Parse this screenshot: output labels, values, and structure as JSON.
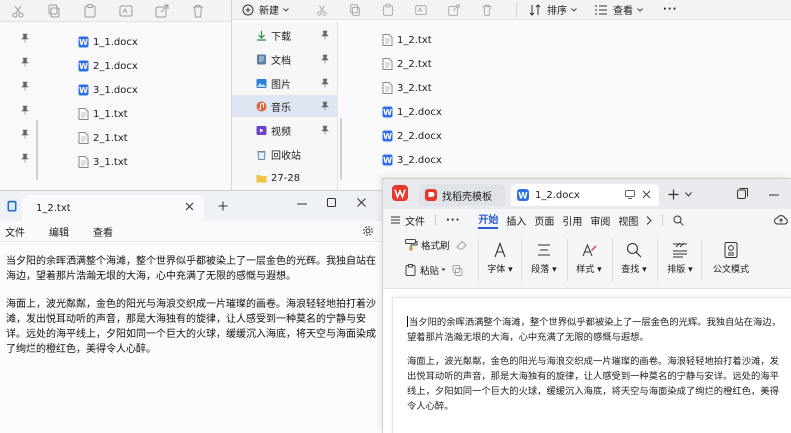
{
  "explorer_left": {
    "files": [
      {
        "name": "1_1.docx",
        "type": "docx"
      },
      {
        "name": "2_1.docx",
        "type": "docx"
      },
      {
        "name": "3_1.docx",
        "type": "docx"
      },
      {
        "name": "1_1.txt",
        "type": "txt"
      },
      {
        "name": "2_1.txt",
        "type": "txt"
      },
      {
        "name": "3_1.txt",
        "type": "txt"
      }
    ]
  },
  "explorer_right": {
    "toolbar": {
      "new_label": "新建",
      "sort_label": "排序",
      "view_label": "查看",
      "more_label": "···"
    },
    "nav": [
      {
        "label": "下载",
        "icon": "download-icon"
      },
      {
        "label": "文档",
        "icon": "document-icon"
      },
      {
        "label": "图片",
        "icon": "picture-icon"
      },
      {
        "label": "音乐",
        "icon": "music-icon"
      },
      {
        "label": "视频",
        "icon": "video-icon"
      },
      {
        "label": "回收站",
        "icon": "recycle-bin-icon"
      },
      {
        "label": "27-28",
        "icon": "folder-icon"
      }
    ],
    "files": [
      {
        "name": "1_2.txt",
        "type": "txt"
      },
      {
        "name": "2_2.txt",
        "type": "txt"
      },
      {
        "name": "3_2.txt",
        "type": "txt"
      },
      {
        "name": "1_2.docx",
        "type": "docx"
      },
      {
        "name": "2_2.docx",
        "type": "docx"
      },
      {
        "name": "3_2.docx",
        "type": "docx"
      }
    ]
  },
  "notepad": {
    "tab_title": "1_2.txt",
    "menu": [
      "文件",
      "编辑",
      "查看"
    ],
    "paragraphs": [
      "当夕阳的余晖洒满整个海滩，整个世界似乎都被染上了一层金色的光辉。我独自站在海边，望着那片浩瀚无垠的大海，心中充满了无限的感慨与遐想。",
      "海面上，波光粼粼，金色的阳光与海浪交织成一片璀璨的画卷。海浪轻轻地拍打着沙滩，发出悦耳动听的声音，那是大海独有的旋律，让人感受到一种莫名的宁静与安详。远处的海平线上，夕阳如同一个巨大的火球，缓缓沉入海底，将天空与海面染成了绚烂的橙红色，美得令人心醉。"
    ]
  },
  "wps": {
    "tabs": [
      {
        "label": "找稻壳模板"
      },
      {
        "label": "1_2.docx"
      }
    ],
    "menu": {
      "file": "文件",
      "items": [
        "开始",
        "插入",
        "页面",
        "引用",
        "审阅",
        "视图"
      ],
      "active": "开始"
    },
    "ribbon": {
      "format_painter": "格式刷",
      "paste": "粘贴",
      "font": "字体",
      "paragraph": "段落",
      "style": "样式",
      "find": "查找",
      "layout": "排版",
      "official": "公文模式"
    },
    "paragraphs": [
      "当夕阳的余晖洒满整个海滩，整个世界似乎都被染上了一层金色的光辉。我独自站在海边，望着那片浩瀚无垠的大海，心中充满了无限的感慨与遐想。",
      "海面上，波光粼粼，金色的阳光与海浪交织成一片璀璨的画卷。海浪轻轻地拍打着沙滩，发出悦耳动听的声音，那是大海独有的旋律，让人感受到一种莫名的宁静与安详。远处的海平线上，夕阳如同一个巨大的火球，缓缓沉入海底，将天空与海面染成了绚烂的橙红色，美得令人心醉。"
    ],
    "colors": {
      "accent": "#2e59d9",
      "wps_red": "#e8372c",
      "docx_blue": "#2f6fe4"
    }
  }
}
